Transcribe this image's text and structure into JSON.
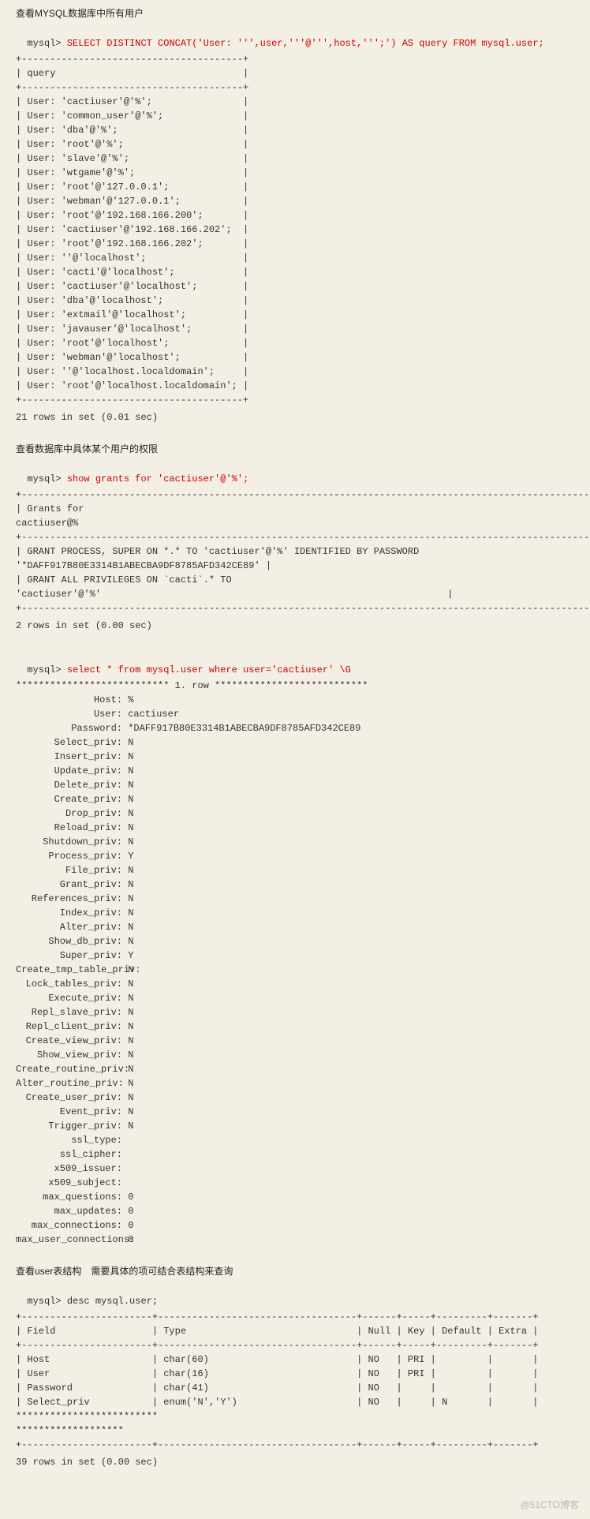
{
  "s1": {
    "title": "查看MYSQL数据库中所有用户",
    "prompt": "mysql> ",
    "cmd": "SELECT DISTINCT CONCAT('User: ''',user,'''@''',host,''';') AS query FROM mysql.user;",
    "sep": "+---------------------------------------+",
    "header": "| query                                 |",
    "rows": [
      "| User: 'cactiuser'@'%';                |",
      "| User: 'common_user'@'%';              |",
      "| User: 'dba'@'%';                      |",
      "| User: 'root'@'%';                     |",
      "| User: 'slave'@'%';                    |",
      "| User: 'wtgame'@'%';                   |",
      "| User: 'root'@'127.0.0.1';             |",
      "| User: 'webman'@'127.0.0.1';           |",
      "| User: 'root'@'192.168.166.200';       |",
      "| User: 'cactiuser'@'192.168.166.202';  |",
      "| User: 'root'@'192.168.166.202';       |",
      "| User: ''@'localhost';                 |",
      "| User: 'cacti'@'localhost';            |",
      "| User: 'cactiuser'@'localhost';        |",
      "| User: 'dba'@'localhost';              |",
      "| User: 'extmail'@'localhost';          |",
      "| User: 'javauser'@'localhost';         |",
      "| User: 'root'@'localhost';             |",
      "| User: 'webman'@'localhost';           |",
      "| User: ''@'localhost.localdomain';     |",
      "| User: 'root'@'localhost.localdomain'; |"
    ],
    "footer": "21 rows in set (0.01 sec)"
  },
  "s2": {
    "title": "查看数据库中具体某个用户的权限",
    "prompt": "mysql> ",
    "cmd": "show grants for 'cactiuser'@'%';",
    "sep_long": "+-------------------------------------------------------------------------------------------------------------------+",
    "hline": "| Grants for",
    "hline2": "cactiuser@%                                                                                            |",
    "sep_long2": "+-------------------------------------------------------------------------------------------------------------------+",
    "g1": "| GRANT PROCESS, SUPER ON *.* TO 'cactiuser'@'%' IDENTIFIED BY PASSWORD",
    "g1b": "'*DAFF917B80E3314B1ABECBA9DF8785AFD342CE89' |",
    "g2": "| GRANT ALL PRIVILEGES ON `cacti`.* TO",
    "g2b": "'cactiuser'@'%'                                                             |",
    "footer": "2 rows in set (0.00 sec)"
  },
  "s3": {
    "prompt": "mysql> ",
    "cmd": "select * from mysql.user where user='cactiuser' \\G",
    "rowsep": "*************************** 1. row ***************************",
    "fields": [
      {
        "k": "Host:",
        "v": "%"
      },
      {
        "k": "User:",
        "v": "cactiuser"
      },
      {
        "k": "Password:",
        "v": "*DAFF917B80E3314B1ABECBA9DF8785AFD342CE89"
      },
      {
        "k": "Select_priv:",
        "v": "N"
      },
      {
        "k": "Insert_priv:",
        "v": "N"
      },
      {
        "k": "Update_priv:",
        "v": "N"
      },
      {
        "k": "Delete_priv:",
        "v": "N"
      },
      {
        "k": "Create_priv:",
        "v": "N"
      },
      {
        "k": "Drop_priv:",
        "v": "N"
      },
      {
        "k": "Reload_priv:",
        "v": "N"
      },
      {
        "k": "Shutdown_priv:",
        "v": "N"
      },
      {
        "k": "Process_priv:",
        "v": "Y"
      },
      {
        "k": "File_priv:",
        "v": "N"
      },
      {
        "k": "Grant_priv:",
        "v": "N"
      },
      {
        "k": "References_priv:",
        "v": "N"
      },
      {
        "k": "Index_priv:",
        "v": "N"
      },
      {
        "k": "Alter_priv:",
        "v": "N"
      },
      {
        "k": "Show_db_priv:",
        "v": "N"
      },
      {
        "k": "Super_priv:",
        "v": "Y"
      },
      {
        "k": "Create_tmp_table_priv:",
        "v": "N"
      },
      {
        "k": "Lock_tables_priv:",
        "v": "N"
      },
      {
        "k": "Execute_priv:",
        "v": "N"
      },
      {
        "k": "Repl_slave_priv:",
        "v": "N"
      },
      {
        "k": "Repl_client_priv:",
        "v": "N"
      },
      {
        "k": "Create_view_priv:",
        "v": "N"
      },
      {
        "k": "Show_view_priv:",
        "v": "N"
      },
      {
        "k": "Create_routine_priv:",
        "v": "N"
      },
      {
        "k": "Alter_routine_priv:",
        "v": "N"
      },
      {
        "k": "Create_user_priv:",
        "v": "N"
      },
      {
        "k": "Event_priv:",
        "v": "N"
      },
      {
        "k": "Trigger_priv:",
        "v": "N"
      },
      {
        "k": "ssl_type:",
        "v": ""
      },
      {
        "k": "ssl_cipher:",
        "v": ""
      },
      {
        "k": "x509_issuer:",
        "v": ""
      },
      {
        "k": "x509_subject:",
        "v": ""
      },
      {
        "k": "max_questions:",
        "v": "0"
      },
      {
        "k": "max_updates:",
        "v": "0"
      },
      {
        "k": "max_connections:",
        "v": "0"
      },
      {
        "k": "max_user_connections:",
        "v": "0"
      }
    ]
  },
  "s4": {
    "title": "查看user表结构　需要具体的项可结合表结构来查询",
    "prompt": "mysql> ",
    "cmd": "desc mysql.user;",
    "sep": "+-----------------------+-----------------------------------+------+-----+---------+-------+",
    "header": "| Field                 | Type                              | Null | Key | Default | Extra |",
    "rows": [
      "| Host                  | char(60)                          | NO   | PRI |         |       |",
      "| User                  | char(16)                          | NO   | PRI |         |       |",
      "| Password              | char(41)                          | NO   |     |         |       |",
      "| Select_priv           | enum('N','Y')                     | NO   |     | N       |       |"
    ],
    "dots1": "*************************",
    "dots2": "*******************",
    "footer": "39 rows in set (0.00 sec)"
  },
  "watermark": "@51CTO博客"
}
